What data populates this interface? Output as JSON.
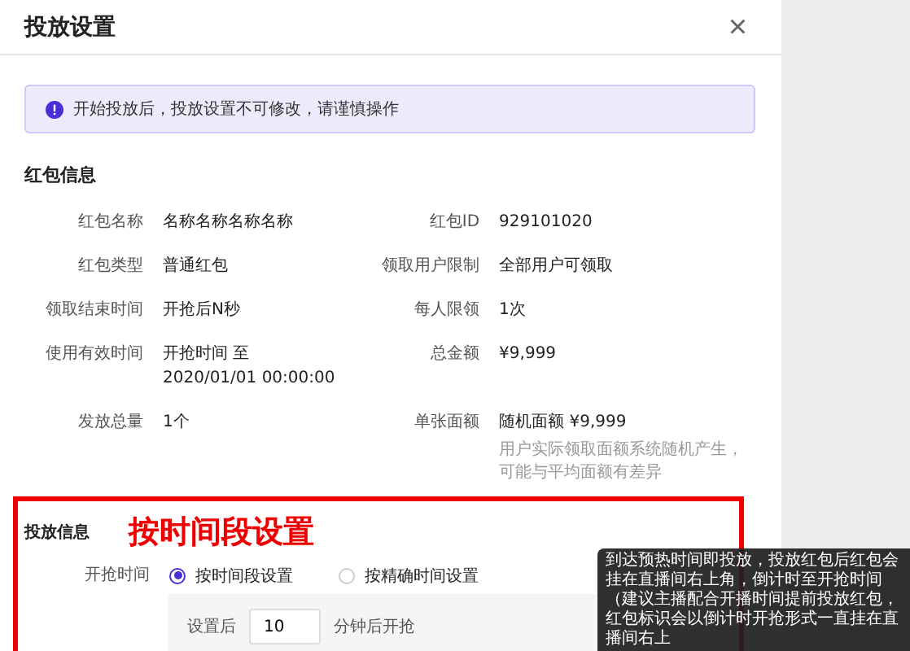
{
  "dialog": {
    "title": "投放设置",
    "close_label": "×"
  },
  "alert": {
    "text": "开始投放后，投放设置不可修改，请谨慎操作"
  },
  "packet_info": {
    "heading": "红包信息",
    "rows": [
      {
        "left": {
          "label": "红包名称",
          "value": "名称名称名称名称"
        },
        "right": {
          "label": "红包ID",
          "value": "929101020"
        }
      },
      {
        "left": {
          "label": "红包类型",
          "value": "普通红包"
        },
        "right": {
          "label": "领取用户限制",
          "value": "全部用户可领取"
        }
      },
      {
        "left": {
          "label": "领取结束时间",
          "value": "开抢后N秒"
        },
        "right": {
          "label": "每人限领",
          "value": "1次"
        }
      },
      {
        "left": {
          "label": "使用有效时间",
          "value": "开抢时间 至",
          "value_line2": "2020/01/01 00:00:00"
        },
        "right": {
          "label": "总金额",
          "value": "¥9,999"
        }
      },
      {
        "left": {
          "label": "发放总量",
          "value": "1个"
        },
        "right": {
          "label": "单张面额",
          "value": "随机面额 ¥9,999",
          "note": "用户实际领取面额系统随机产生，可能与平均面额有差异"
        }
      }
    ]
  },
  "delivery_info": {
    "heading": "投放信息",
    "annotation": "按时间段设置",
    "start_time": {
      "label": "开抢时间",
      "options": [
        {
          "label": "按时间段设置",
          "selected": true
        },
        {
          "label": "按精确时间设置",
          "selected": false
        }
      ]
    },
    "delay": {
      "prefix": "设置后",
      "value": "10",
      "suffix": "分钟后开抢"
    }
  },
  "tooltip": {
    "text": "到达预热时间即投放，投放红包后红包会挂在直播间右上角，倒计时至开抢时间（建议主播配合开播时间提前投放红包，红包标识会以倒计时开抢形式一直挂在直播间右上"
  }
}
